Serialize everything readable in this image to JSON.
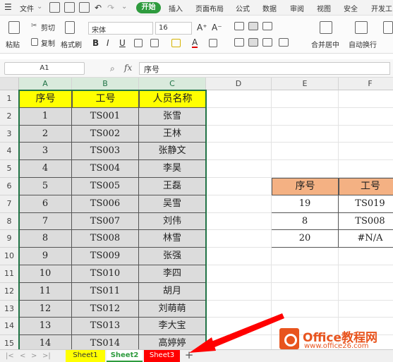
{
  "menubar": {
    "menu_label": "文件",
    "tabs": [
      "开始",
      "插入",
      "页面布局",
      "公式",
      "数据",
      "审阅",
      "视图",
      "安全",
      "开发工"
    ]
  },
  "ribbon": {
    "paste": "粘贴",
    "cut": "剪切",
    "copy": "复制",
    "format_painter": "格式刷",
    "font_name": "宋体",
    "font_size": "16",
    "font_grow": "A⁺",
    "font_shrink": "A⁻",
    "bold": "B",
    "italic": "I",
    "underline": "U",
    "merge": "合并居中",
    "wrap": "自动换行"
  },
  "formula_bar": {
    "name_box": "A1",
    "fx": "fx",
    "content": "序号"
  },
  "columns": [
    "A",
    "B",
    "C",
    "D",
    "E",
    "F"
  ],
  "rows": [
    "1",
    "2",
    "3",
    "4",
    "5",
    "6",
    "7",
    "8",
    "9",
    "10",
    "11",
    "12",
    "13",
    "14",
    "15"
  ],
  "table_left": {
    "headers": [
      "序号",
      "工号",
      "人员名称"
    ],
    "rows": [
      [
        "1",
        "TS001",
        "张雪"
      ],
      [
        "2",
        "TS002",
        "王林"
      ],
      [
        "3",
        "TS003",
        "张静文"
      ],
      [
        "4",
        "TS004",
        "李昊"
      ],
      [
        "5",
        "TS005",
        "王磊"
      ],
      [
        "6",
        "TS006",
        "吴雪"
      ],
      [
        "7",
        "TS007",
        "刘伟"
      ],
      [
        "8",
        "TS008",
        "林雪"
      ],
      [
        "9",
        "TS009",
        "张强"
      ],
      [
        "10",
        "TS010",
        "李四"
      ],
      [
        "11",
        "TS011",
        "胡月"
      ],
      [
        "12",
        "TS012",
        "刘萌萌"
      ],
      [
        "13",
        "TS013",
        "李大宝"
      ],
      [
        "14",
        "TS014",
        "高婷婷"
      ]
    ]
  },
  "table_right": {
    "headers": [
      "序号",
      "工号"
    ],
    "rows": [
      [
        "19",
        "TS019"
      ],
      [
        "8",
        "TS008"
      ],
      [
        "20",
        "#N/A"
      ]
    ]
  },
  "sheets": [
    "Sheet1",
    "Sheet2",
    "Sheet3"
  ],
  "add_sheet": "+",
  "watermark": {
    "title": "Office教程网",
    "url": "www.office26.com"
  },
  "colors": {
    "accent": "#2e9b3e",
    "sheet1": "#ffff00",
    "sheet3": "#ff0000",
    "header_orange": "#f4b183",
    "arrow": "#ff0000"
  }
}
